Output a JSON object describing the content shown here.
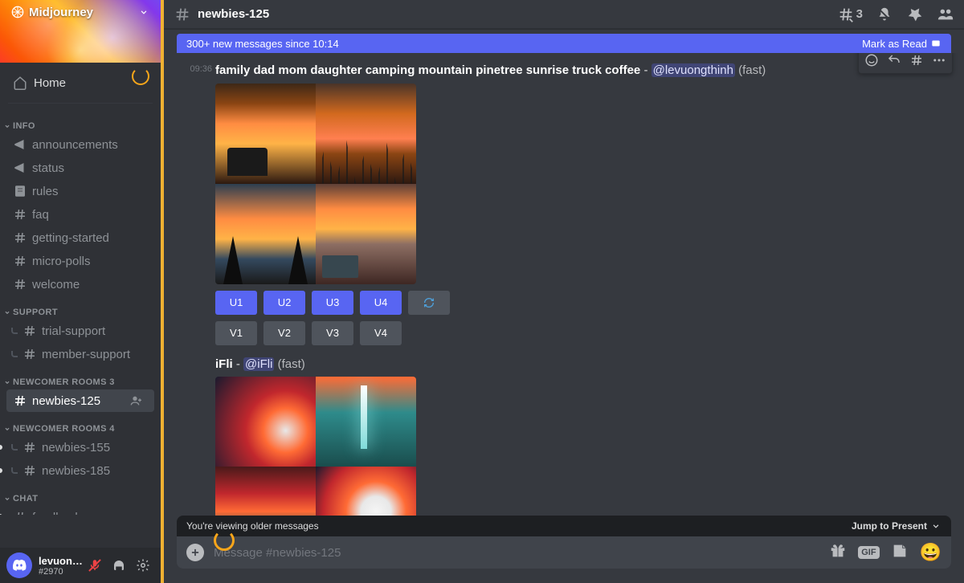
{
  "server": {
    "name": "Midjourney"
  },
  "sidebar": {
    "home": "Home",
    "categories": [
      {
        "label": "INFO",
        "channels": [
          {
            "icon": "megaphone",
            "name": "announcements"
          },
          {
            "icon": "megaphone",
            "name": "status"
          },
          {
            "icon": "rules",
            "name": "rules"
          },
          {
            "icon": "hash",
            "name": "faq"
          },
          {
            "icon": "hash",
            "name": "getting-started"
          },
          {
            "icon": "hash",
            "name": "micro-polls"
          },
          {
            "icon": "hash",
            "name": "welcome"
          }
        ]
      },
      {
        "label": "SUPPORT",
        "channels": [
          {
            "icon": "hash",
            "name": "trial-support",
            "thread": true
          },
          {
            "icon": "hash",
            "name": "member-support",
            "thread": true
          }
        ]
      },
      {
        "label": "NEWCOMER ROOMS 3",
        "channels": [
          {
            "icon": "hash",
            "name": "newbies-125",
            "active": true,
            "addPeople": true
          }
        ]
      },
      {
        "label": "NEWCOMER ROOMS 4",
        "channels": [
          {
            "icon": "hash",
            "name": "newbies-155",
            "thread": true,
            "dot": true
          },
          {
            "icon": "hash",
            "name": "newbies-185",
            "thread": true,
            "dot": true
          }
        ]
      },
      {
        "label": "CHAT",
        "channels": [
          {
            "icon": "hash",
            "name": "feedback",
            "dot": true,
            "cut": true
          }
        ]
      }
    ]
  },
  "user": {
    "name": "levuongthi...",
    "tag": "#2970"
  },
  "header": {
    "channel": "newbies-125",
    "threadCount": "3"
  },
  "newbar": {
    "text": "300+ new messages since 10:14",
    "mark": "Mark as Read"
  },
  "messages": [
    {
      "time": "09:36",
      "prompt": "family dad mom daughter camping mountain pinetree sunrise truck coffee",
      "mention": "@levuongthinh",
      "mode": "(fast)",
      "buttons_u": [
        "U1",
        "U2",
        "U3",
        "U4"
      ],
      "buttons_v": [
        "V1",
        "V2",
        "V3",
        "V4"
      ],
      "style": "camp"
    },
    {
      "prompt": "iFli",
      "mention": "@iFli",
      "mode": "(fast)",
      "style": "abs"
    }
  ],
  "bottom": {
    "older": "You're viewing older messages",
    "jump": "Jump to Present",
    "placeholder": "Message #newbies-125"
  }
}
